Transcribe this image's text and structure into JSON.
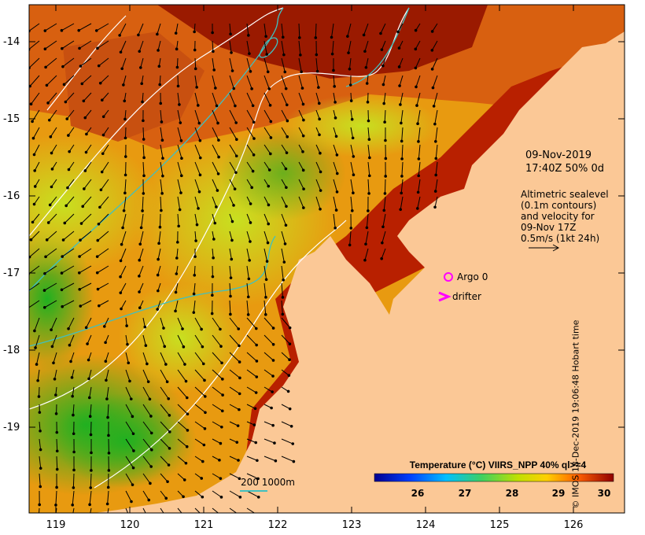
{
  "map": {
    "y_ticks": [
      "-14",
      "-15",
      "-16",
      "-17",
      "-18",
      "-19"
    ],
    "x_ticks": [
      "119",
      "120",
      "121",
      "122",
      "123",
      "124",
      "125",
      "126"
    ],
    "colors": {
      "land": "#fbc896",
      "hot": "#8b0000",
      "warm": "#e07000",
      "mid": "#f0c000",
      "cool": "#40c000",
      "cooler": "#00a020",
      "contour": "#ffffff",
      "isobath": "#40c0c0",
      "marker": "#ff00ff"
    }
  },
  "info": {
    "date": "09-Nov-2019",
    "time": "17:40Z  50% 0d",
    "alt_line1": "Altimetric sealevel",
    "alt_line2": "(0.1m contours)",
    "alt_line3": "and velocity for",
    "alt_line4": "09-Nov 17Z",
    "alt_line5": "0.5m/s (1kt 24h)"
  },
  "legend": {
    "argo": "Argo 0",
    "drifter": "drifter",
    "isobath": "200  1000m"
  },
  "colorbar": {
    "title": "Temperature (°C) VIIRS_NPP 40% ql>=4",
    "ticks": [
      "26",
      "27",
      "28",
      "29",
      "30"
    ]
  },
  "credit": "© IMOS 18-Dec-2019 19:06:48 Hobart time"
}
